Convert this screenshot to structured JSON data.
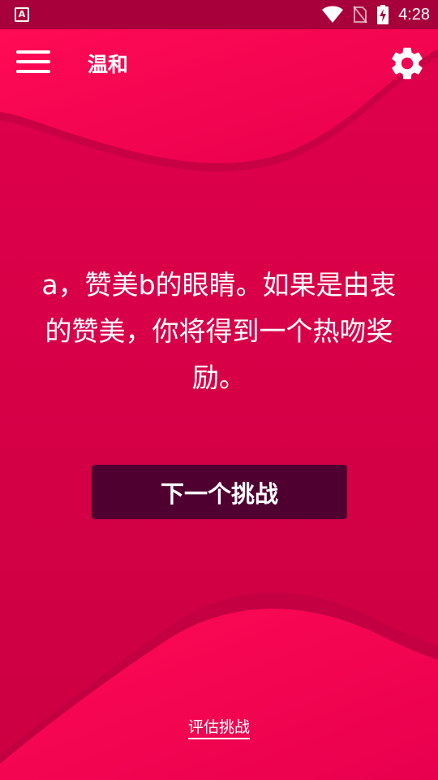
{
  "status_bar": {
    "app_icon_letter": "A",
    "time": "4:28",
    "icons": [
      "wifi-icon",
      "no-sim-icon",
      "battery-charging-icon"
    ]
  },
  "app_bar": {
    "title": "温和",
    "menu_icon": "menu-icon",
    "settings_icon": "gear-icon"
  },
  "challenge": {
    "text": "a，赞美b的眼睛。如果是由衷的赞美，你将得到一个热吻奖励。"
  },
  "actions": {
    "next_label": "下一个挑战",
    "rate_label": "评估挑战"
  },
  "colors": {
    "background": "#d8004a",
    "wave_light": "#ff0a55",
    "status_bar": "#a8003a",
    "button": "#4f0030"
  }
}
